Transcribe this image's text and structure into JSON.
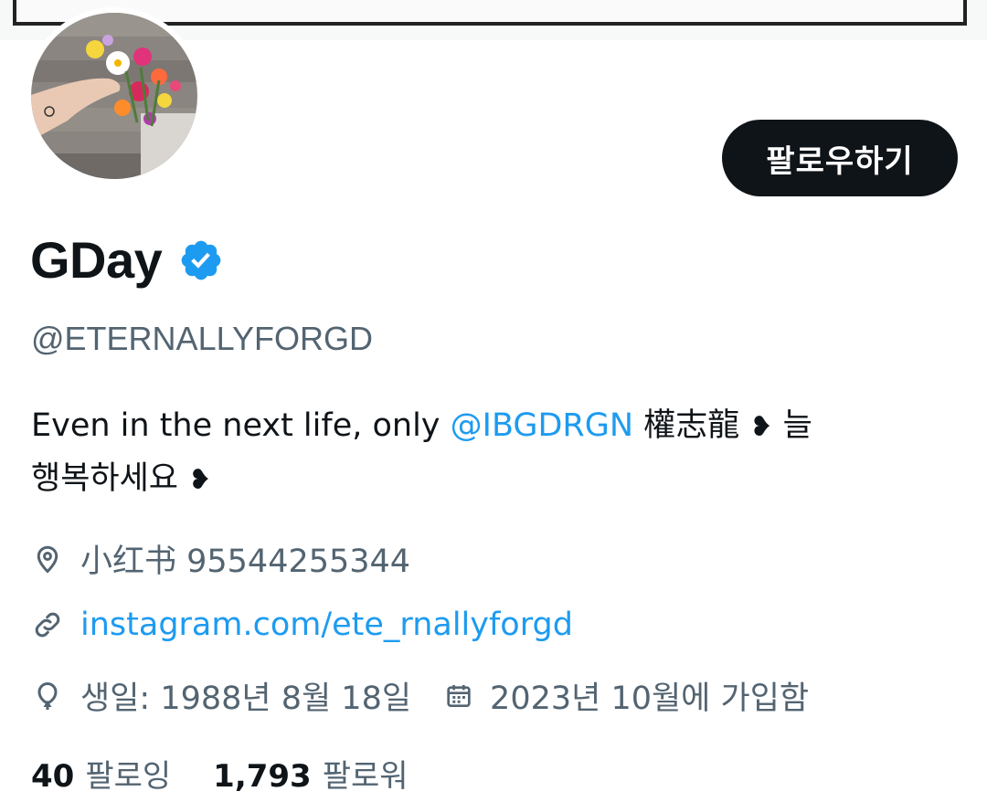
{
  "profile": {
    "display_name": "GDay",
    "handle": "@ETERNALLYFORGD",
    "follow_label": "팔로우하기",
    "bio": {
      "text_before": "Even in the next life, only ",
      "mention": "@IBGDRGN",
      "text_after": " 權志龍 ",
      "heart_1": "❥",
      "line_1_end": " 늘",
      "line_2": "행복하세요 ",
      "heart_2": "❥"
    },
    "location": "小红书 95544255344",
    "website": "instagram.com/ete_rnallyforgd",
    "birthday": "생일: 1988년 8월 18일",
    "joined": "2023년 10월에 가입함"
  },
  "stats": {
    "following_count": "40",
    "following_label": "팔로잉",
    "followers_count": "1,793",
    "followers_label": "팔로워"
  },
  "colors": {
    "accent": "#1d9bf0",
    "text": "#0f1419",
    "secondary": "#536471"
  },
  "icons": {
    "verified": "verified-badge-icon",
    "location": "location-pin-icon",
    "website": "link-icon",
    "birthday": "balloon-icon",
    "joined": "calendar-icon"
  }
}
